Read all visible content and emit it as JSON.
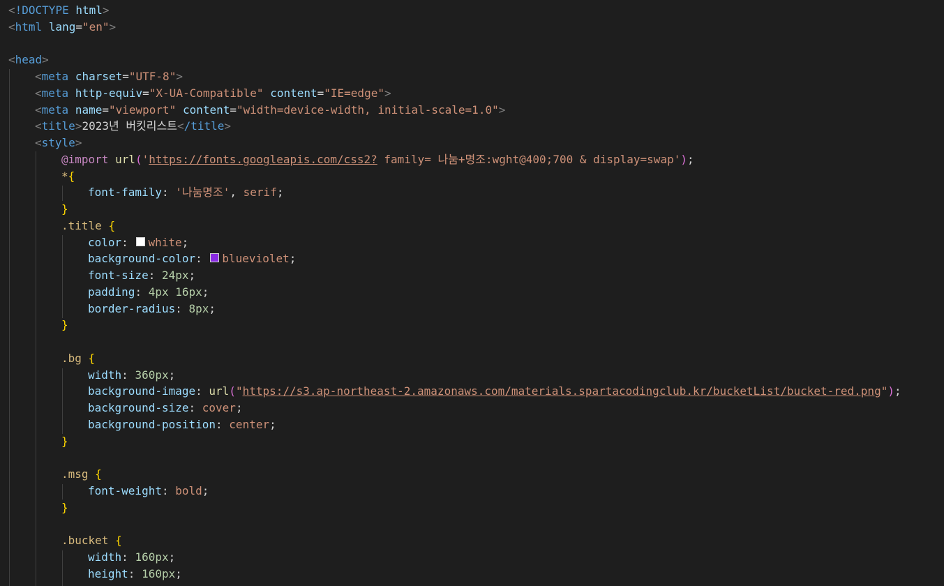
{
  "editor": {
    "theme_background": "#1e1e1e",
    "colors": {
      "tag": "#569cd6",
      "attribute": "#9cdcfe",
      "string": "#ce9178",
      "selector": "#d7ba7d",
      "number": "#b5cea8",
      "brace": "#ffd700",
      "at_rule": "#c586c0",
      "function": "#dcdcaa"
    },
    "color_swatches": {
      "white": "#ffffff",
      "blueviolet": "#8a2be2"
    }
  },
  "code": {
    "l1_doctype": "!DOCTYPE",
    "l1_html": "html",
    "l2_tag": "html",
    "l2_attr": "lang",
    "l2_val": "\"en\"",
    "l4_tag": "head",
    "l5_tag": "meta",
    "l5_attr": "charset",
    "l5_val": "\"UTF-8\"",
    "l6_tag": "meta",
    "l6_attr1": "http-equiv",
    "l6_val1": "\"X-UA-Compatible\"",
    "l6_attr2": "content",
    "l6_val2": "\"IE=edge\"",
    "l7_tag": "meta",
    "l7_attr1": "name",
    "l7_val1": "\"viewport\"",
    "l7_attr2": "content",
    "l7_val2": "\"width=device-width, initial-scale=1.0\"",
    "l8_tag_open": "title",
    "l8_text": "2023년 버킷리스트",
    "l8_tag_close": "/title",
    "l9_tag": "style",
    "l10_at": "@import",
    "l10_func": "url",
    "l10_quote_open": "'",
    "l10_link": "https://fonts.googleapis.com/css2?",
    "l10_rest": " family= 나눔+명조:wght@400;700 & display=swap",
    "l10_quote_close": "'",
    "l11_selector": "*",
    "l11_brace": "{",
    "l12_prop": "font-family",
    "l12_val1": "'나눔명조'",
    "l12_val2": "serif",
    "l13_brace": "}",
    "l14_selector": ".title",
    "l14_brace": "{",
    "l15_prop": "color",
    "l15_val": "white",
    "l16_prop": "background-color",
    "l16_val": "blueviolet",
    "l17_prop": "font-size",
    "l17_val": "24px",
    "l18_prop": "padding",
    "l18_val": "4px 16px",
    "l19_prop": "border-radius",
    "l19_val": "8px",
    "l20_brace": "}",
    "l22_selector": ".bg",
    "l22_brace": "{",
    "l23_prop": "width",
    "l23_val": "360px",
    "l24_prop": "background-image",
    "l24_func": "url",
    "l24_quote_open": "\"",
    "l24_link": "https://s3.ap-northeast-2.amazonaws.com/materials.spartacodingclub.kr/bucketList/bucket-red.png",
    "l24_quote_close": "\"",
    "l25_prop": "background-size",
    "l25_val": "cover",
    "l26_prop": "background-position",
    "l26_val": "center",
    "l27_brace": "}",
    "l29_selector": ".msg",
    "l29_brace": "{",
    "l30_prop": "font-weight",
    "l30_val": "bold",
    "l31_brace": "}",
    "l33_selector": ".bucket",
    "l33_brace": "{",
    "l34_prop": "width",
    "l34_val": "160px",
    "l35_prop": "height",
    "l35_val": "160px"
  }
}
